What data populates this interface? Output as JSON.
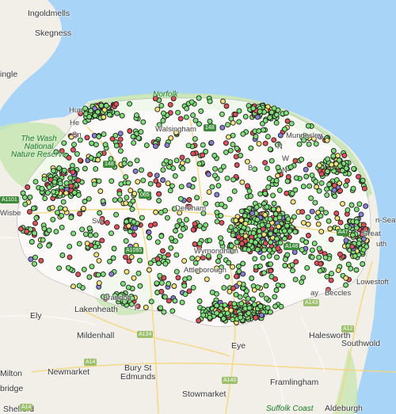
{
  "colors": {
    "sea": "#a8d4f7",
    "land": "#f2efe9",
    "park": "#c8e6b4",
    "marker_green": "#7fe07a",
    "marker_red": "#e0505a",
    "marker_yellow": "#f4e27a",
    "marker_purple": "#8a7fd6",
    "marker_outline": "#1d1d1d",
    "road_badge": "#3d8a3a"
  },
  "labels": {
    "ingoldmells": "Ingoldmells",
    "skegness": "Skegness",
    "ingle": "ingle",
    "the_wash": "The Wash\nNational\nNature Reserve",
    "norfolk": "Norfolk",
    "hunstanton": "Hun",
    "heacham": "He",
    "snettisham": "Sn",
    "walsingham": "Walsingham",
    "mundesley": "Mundesley",
    "wisbech": "Wisbe",
    "swaffham": "Sw",
    "dereham": "Dereham",
    "wymondham": "Wymondham",
    "attleborough": "Attleborough",
    "brandon": "Brandon",
    "lakenheath": "Lakenheath",
    "ely": "Ely",
    "mildenhall": "Mildenhall",
    "thetford": "T",
    "great_yarmouth": "Great",
    "yarmouth_cut": "uth",
    "sea_cut": "n-Sea",
    "lowestoft": "Lowestoft",
    "bungay_beccles": "ay   Beccles",
    "halesworth": "Halesworth",
    "southwold": "Southwold",
    "eye": "Eye",
    "bury": "Bury St\nEdmunds",
    "newmarket": "Newmarket",
    "milton": "Milton",
    "bridge": "bridge",
    "framlingham": "Framlingham",
    "stowmarket": "Stowmarket",
    "aldeburgh": "Aldeburgh",
    "shelford": "Shelford",
    "suffolk_coast": "Suffolk Coast",
    "w1": "W",
    "n1": "N",
    "n2": "N",
    "b": "B"
  },
  "roads": {
    "a148": "148",
    "a148b": "148",
    "a1065": "A1065",
    "a1101": "A1101",
    "a134": "A134",
    "a14": "A14",
    "a14b": "A14",
    "a140": "A140",
    "a12": "A12",
    "a47": "A47",
    "a146": "A146",
    "a143": "A143",
    "a065": "065"
  }
}
